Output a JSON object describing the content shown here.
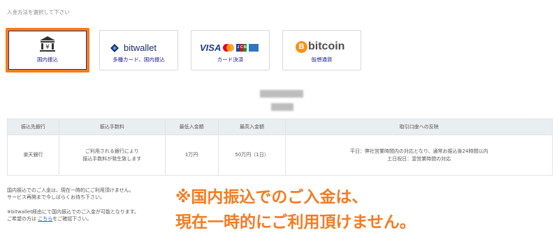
{
  "instruction": "入金方法を選択して下さい",
  "methods": {
    "bank": {
      "label": "国内振込",
      "icon": "bank-icon",
      "icon_glyph": "¥"
    },
    "bitwallet": {
      "label": "多種カード、国内振込",
      "logo_text": "bitwallet"
    },
    "card": {
      "label": "カード決済",
      "logo_text": "VISA",
      "jcb_letters": [
        "J",
        "C",
        "B"
      ]
    },
    "bitcoin": {
      "label": "仮想通貨",
      "logo_text": "bitcoin",
      "coin_glyph": "B"
    }
  },
  "table": {
    "headers": [
      "振込先銀行",
      "振込手数料",
      "最低入金額",
      "最高入金額",
      "取引口座への反映"
    ],
    "row": {
      "bank": "楽天銀行",
      "fee_line1": "ご利用される銀行により",
      "fee_line2": "振込手数料が発生致します",
      "min": "1万円",
      "max": "50万円（1日）",
      "reflect_line1": "平日：弊社営業時間内の対応となり、通常お振込後24時間以内",
      "reflect_line2": "土日祝日：翌営業時間の対応"
    }
  },
  "notes": {
    "line1": "国内振込でのご入金は、現在一時的にご利用頂けません。",
    "line2": "サービス再開まで今しばらくお待ち下さい。",
    "line3": "※bitwallet経由にて国内振込でのご入金が可能となります。",
    "line4_prefix": "ご希望の方は",
    "line4_link": "こちら",
    "line4_suffix": "をご確認下さい。"
  },
  "notice": {
    "line1": "※国内振込でのご入金は、",
    "line2": "現在一時的にご利用頂けません。"
  },
  "colors": {
    "accent": "#f47b20",
    "link": "#2a5ab8",
    "header_bg": "#e9eef0",
    "label": "#1a1a8c"
  }
}
